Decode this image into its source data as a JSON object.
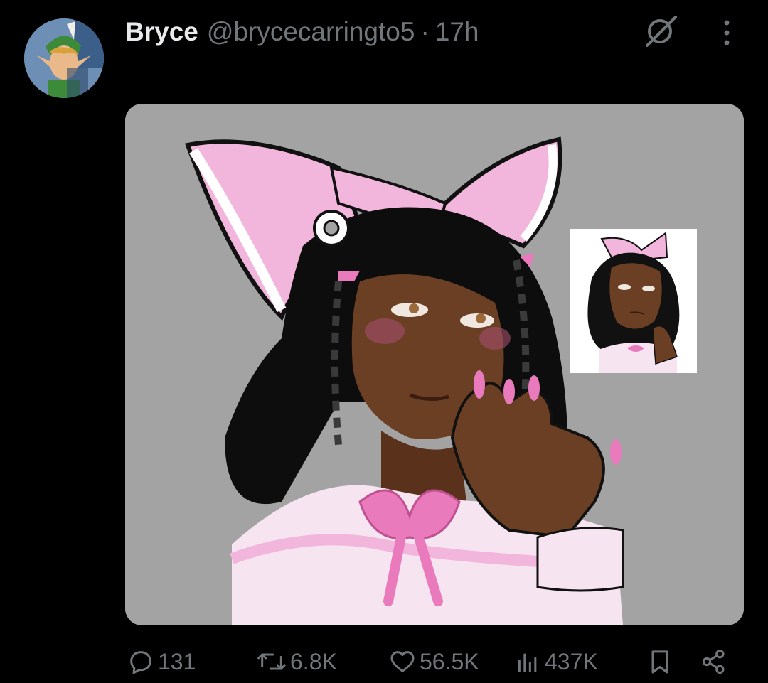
{
  "tweet": {
    "display_name": "Bryce",
    "handle": "@brycecarringto5",
    "separator": "·",
    "time": "17h"
  },
  "media": {
    "background": "#a3a3a3"
  },
  "actions": {
    "replies": "131",
    "reposts": "6.8K",
    "likes": "56.5K",
    "views": "437K"
  },
  "icons": [
    "grok-icon",
    "more-icon",
    "reply-icon",
    "retweet-icon",
    "like-icon",
    "views-icon",
    "bookmark-icon",
    "share-icon"
  ],
  "colors": {
    "background": "#000000",
    "primary_text": "#e7e9ea",
    "secondary_text": "#71767b",
    "bow_pink": "#f2b6dc"
  }
}
